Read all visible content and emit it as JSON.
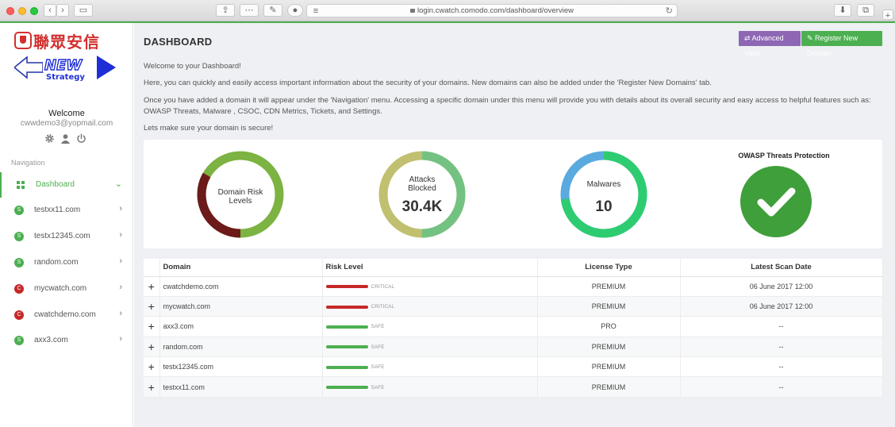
{
  "browser": {
    "url": "login.cwatch.comodo.com/dashboard/overview"
  },
  "sidebar": {
    "logo_text": "聯眾安信",
    "logo_strategy_new": "NEW",
    "logo_strategy_word": "Strategy",
    "welcome": "Welcome",
    "email": "cwwdemo3@yopmail.com",
    "nav_label": "Navigation",
    "items": [
      {
        "label": "Dashboard",
        "badge": "",
        "color": "#4caf50"
      },
      {
        "label": "testxx11.com",
        "badge": "S",
        "color": "#4caf50"
      },
      {
        "label": "testx12345.com",
        "badge": "S",
        "color": "#4caf50"
      },
      {
        "label": "random.com",
        "badge": "S",
        "color": "#4caf50"
      },
      {
        "label": "mycwatch.com",
        "badge": "C",
        "color": "#c62828"
      },
      {
        "label": "cwatchdemo.com",
        "badge": "C",
        "color": "#c62828"
      },
      {
        "label": "axx3.com",
        "badge": "S",
        "color": "#4caf50"
      }
    ]
  },
  "main": {
    "title": "DASHBOARD",
    "advanced_view": "Advanced View",
    "register_domain": "Register New Domain",
    "intro": [
      "Welcome to your Dashboard!",
      "Here, you can quickly and easily access important information about the security of your domains. New domains can also be added under the 'Register New Domains' tab.",
      "Once you have added a domain it will appear under the 'Navigation' menu. Accessing a specific domain under this menu will provide you with details about its overall security and easy access to helpful features such as: OWASP Threats, Malware , CSOC, CDN Metrics, Tickets, and Settings.",
      "Lets make sure your domain is secure!"
    ]
  },
  "gauges": {
    "risk": {
      "label_line1": "Domain Risk",
      "label_line2": "Levels",
      "critical_fraction": 0.333
    },
    "attacks": {
      "label_line1": "Attacks",
      "label_line2": "Blocked",
      "value": "30.4K",
      "fraction": 0.5
    },
    "malwares": {
      "label": "Malwares",
      "value": "10",
      "fraction": 0.73
    },
    "owasp": {
      "title": "OWASP Threats Protection"
    }
  },
  "table": {
    "headers": [
      "Domain",
      "Risk Level",
      "License Type",
      "Latest Scan Date"
    ],
    "rows": [
      {
        "domain": "cwatchdemo.com",
        "risk": "CRITICAL",
        "risk_color": "#c62828",
        "license": "PREMIUM",
        "date": "06 June 2017 12:00"
      },
      {
        "domain": "mycwatch.com",
        "risk": "CRITICAL",
        "risk_color": "#c62828",
        "license": "PREMIUM",
        "date": "06 June 2017 12:00"
      },
      {
        "domain": "axx3.com",
        "risk": "SAFE",
        "risk_color": "#4caf50",
        "license": "PRO",
        "date": "--"
      },
      {
        "domain": "random.com",
        "risk": "SAFE",
        "risk_color": "#4caf50",
        "license": "PREMIUM",
        "date": "--"
      },
      {
        "domain": "testx12345.com",
        "risk": "SAFE",
        "risk_color": "#4caf50",
        "license": "PREMIUM",
        "date": "--"
      },
      {
        "domain": "testxx11.com",
        "risk": "SAFE",
        "risk_color": "#4caf50",
        "license": "PREMIUM",
        "date": "--"
      }
    ]
  },
  "colors": {
    "accent": "#4caf50",
    "purple": "#8e67b4",
    "critical": "#c62828",
    "risk_dark": "#6d1a1a",
    "risk_green": "#7cb342",
    "attacks_light": "#c0c070",
    "attacks_green": "#74c282",
    "malware_blue": "#5aaadf",
    "malware_green": "#2ecc71"
  }
}
